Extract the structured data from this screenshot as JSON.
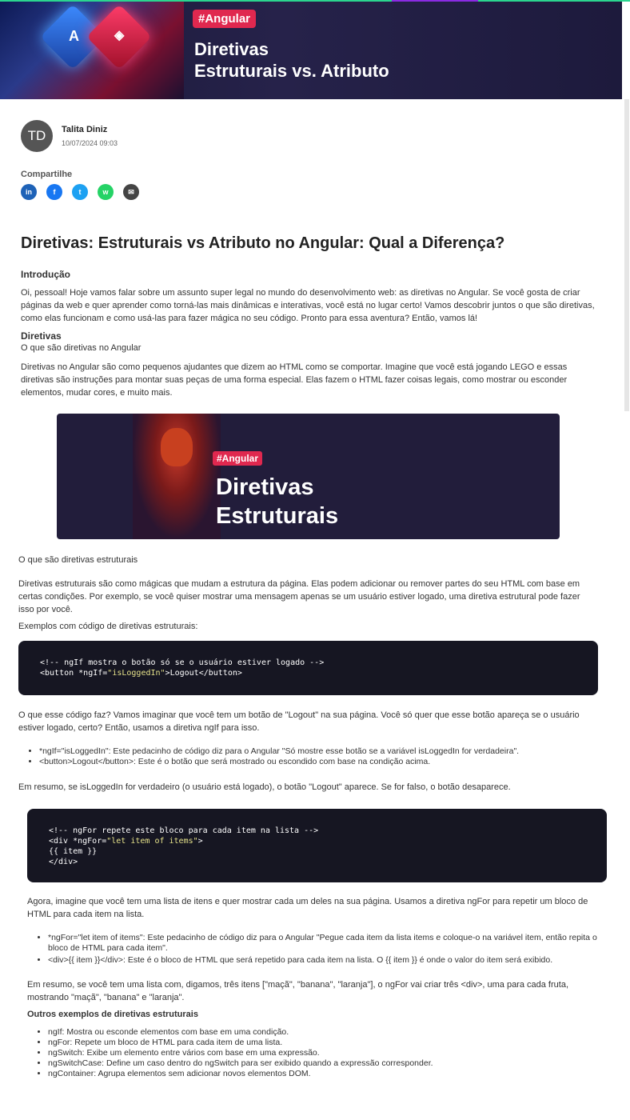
{
  "hero": {
    "tag": "#Angular",
    "title_line1": "Diretivas",
    "title_line2": "Estruturais vs. Atributo",
    "chip_a": "A"
  },
  "author": {
    "initials": "TD",
    "name": "Talita Diniz",
    "date": "10/07/2024 09:03"
  },
  "share": {
    "label": "Compartilhe",
    "buttons": [
      {
        "icon": "linkedin-icon",
        "glyph": "in",
        "color": "#1e62b7"
      },
      {
        "icon": "facebook-icon",
        "glyph": "f",
        "color": "#1877f2"
      },
      {
        "icon": "twitter-icon",
        "glyph": "t",
        "color": "#1da1f2"
      },
      {
        "icon": "whatsapp-icon",
        "glyph": "w",
        "color": "#25d366"
      },
      {
        "icon": "email-icon",
        "glyph": "✉",
        "color": "#444444"
      }
    ]
  },
  "article": {
    "title": "Diretivas: Estruturais vs Atributo no Angular: Qual a Diferença?",
    "intro_heading": "Introdução",
    "intro_text": "Oi, pessoal! Hoje vamos falar sobre um assunto super legal no mundo do desenvolvimento web: as diretivas no Angular. Se você gosta de criar páginas da web e quer aprender como torná-las mais dinâmicas e interativas, você está no lugar certo! Vamos descobrir juntos o que são diretivas, como elas funcionam e como usá-las para fazer mágica no seu código. Pronto para essa aventura? Então, vamos lá!",
    "directives_heading": "Diretivas",
    "directives_sub": "O que são diretivas no Angular",
    "directives_text": "Diretivas no Angular são como pequenos ajudantes que dizem ao HTML como se comportar. Imagine que você está jogando LEGO e essas diretivas são instruções para montar suas peças de uma forma especial. Elas fazem o HTML fazer coisas legais, como mostrar ou esconder elementos, mudar cores, e muito mais.",
    "image2": {
      "tag": "#Angular",
      "line1": "Diretivas",
      "line2": "Estruturais"
    },
    "structural_sub": "O que são diretivas estruturais",
    "structural_text": "Diretivas estruturais são como mágicas que mudam a estrutura da página. Elas podem adicionar ou remover partes do seu HTML com base em certas condições. Por exemplo, se você quiser mostrar uma mensagem apenas se um usuário estiver logado, uma diretiva estrutural pode fazer isso por você.",
    "examples_label": "Exemplos com código de diretivas estruturais:",
    "code1": {
      "line1": "<!-- ngIf mostra o botão só se o usuário estiver logado -->",
      "line2_a": "<button *ngIf=",
      "line2_str": "\"isLoggedIn\"",
      "line2_b": ">Logout</button>"
    },
    "explain1": "O que esse código faz? Vamos imaginar que você tem um botão de \"Logout\" na sua página. Você só quer que esse botão apareça se o usuário estiver logado, certo? Então, usamos a diretiva ngIf para isso.",
    "bullets1": [
      "*ngIf=\"isLoggedIn\": Este pedacinho de código diz para o Angular \"Só mostre esse botão se a variável isLoggedIn for verdadeira\".",
      "<button>Logout</button>: Este é o botão que será mostrado ou escondido com base na condição acima."
    ],
    "summary1": "Em resumo, se isLoggedIn for verdadeiro (o usuário está logado), o botão \"Logout\" aparece. Se for falso, o botão desaparece.",
    "code2": {
      "line1": "<!-- ngFor repete este bloco para cada item na lista -->",
      "line2_a": "<div *ngFor=",
      "line2_str": "\"let item of items\"",
      "line2_b": ">",
      "line3": "{{ item }}",
      "line4": "</div>"
    },
    "explain2": "Agora, imagine que você tem uma lista de itens e quer mostrar cada um deles na sua página. Usamos a diretiva ngFor para repetir um bloco de HTML para cada item na lista.",
    "bullets2": [
      "*ngFor=\"let item of items\": Este pedacinho de código diz para o Angular \"Pegue cada item da lista items e coloque-o na variável item, então repita o bloco de HTML para cada item\".",
      "<div>{{ item }}</div>: Este é o bloco de HTML que será repetido para cada item na lista. O {{ item }} é onde o valor do item será exibido."
    ],
    "summary2": "Em resumo, se você tem uma lista com, digamos, três itens [\"maçã\", \"banana\", \"laranja\"], o ngFor vai criar três <div>, uma para cada fruta, mostrando \"maçã\", \"banana\" e \"laranja\".",
    "others_heading": "Outros exemplos de diretivas estruturais",
    "others": [
      "ngIf: Mostra ou esconde elementos com base em uma condição.",
      "ngFor: Repete um bloco de HTML para cada item de uma lista.",
      "ngSwitch: Exibe um elemento entre vários com base em uma expressão.",
      "ngSwitchCase: Define um caso dentro do ngSwitch para ser exibido quando a expressão corresponder.",
      "ngContainer: Agrupa elementos sem adicionar novos elementos DOM."
    ]
  }
}
